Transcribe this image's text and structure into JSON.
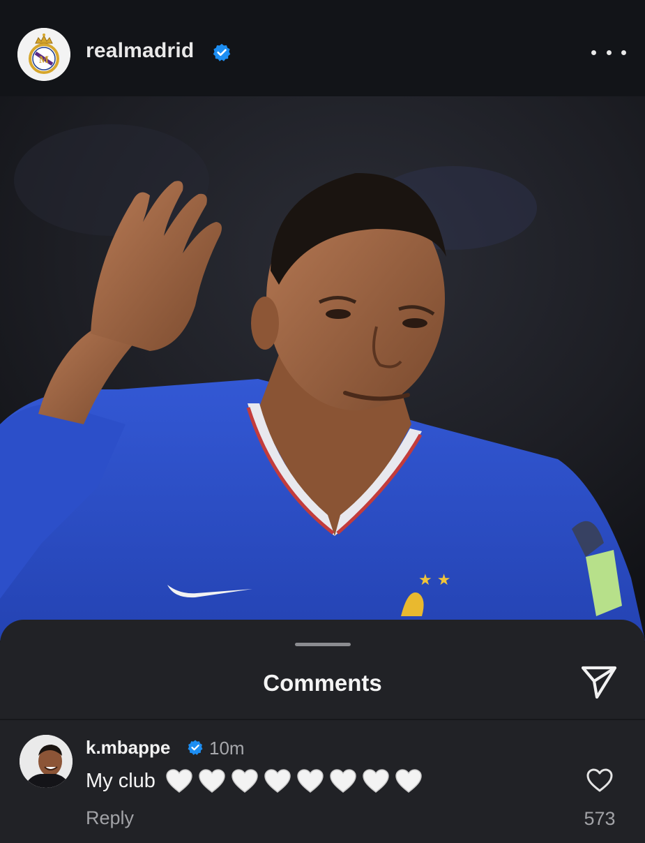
{
  "post": {
    "username": "realmadrid",
    "verified": true,
    "avatar_icon": "real-madrid-crest",
    "more_icon": "more-horizontal-icon"
  },
  "photo": {
    "background_color": "#1c1d22",
    "jersey_color": "#2f51c9"
  },
  "comments_sheet": {
    "title": "Comments",
    "share_icon": "send-icon",
    "comments": [
      {
        "username": "k.mbappe",
        "verified": true,
        "time": "10m",
        "text": "My club",
        "emoji": "🤍🤍🤍🤍🤍🤍🤍🤍",
        "reply_label": "Reply",
        "like_count": "573"
      }
    ]
  },
  "colors": {
    "verified": "#1d8ef2",
    "background": "#0e1013",
    "sheet": "#212226",
    "muted_text": "#a2a3a7"
  }
}
